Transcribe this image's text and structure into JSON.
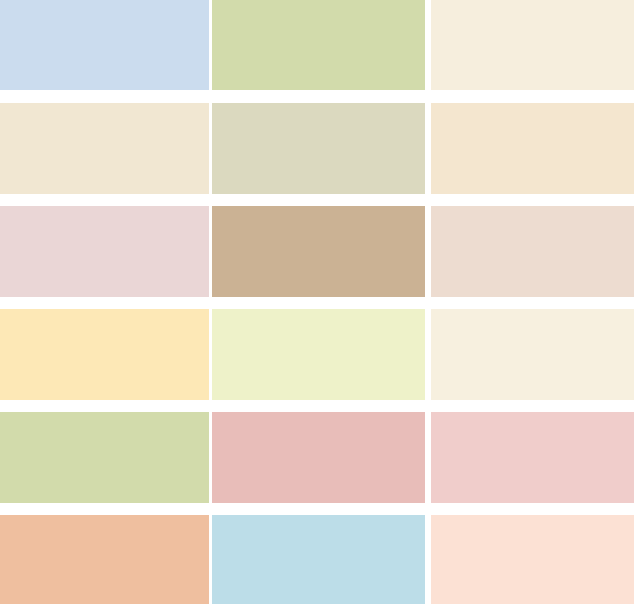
{
  "palette": {
    "swatches": [
      {
        "color": "#cbdcee"
      },
      {
        "color": "#d2dbab"
      },
      {
        "color": "#f6eedd"
      },
      {
        "color": "#f1e7d2"
      },
      {
        "color": "#dbd9bf"
      },
      {
        "color": "#f4e6cf"
      },
      {
        "color": "#ead6d6"
      },
      {
        "color": "#cbb294"
      },
      {
        "color": "#eddcd0"
      },
      {
        "color": "#fde8b6"
      },
      {
        "color": "#eef2c9"
      },
      {
        "color": "#f7f0df"
      },
      {
        "color": "#d2dbab"
      },
      {
        "color": "#e8bdb9"
      },
      {
        "color": "#f0cdcb"
      },
      {
        "color": "#efbf9f"
      },
      {
        "color": "#bcdde8"
      },
      {
        "color": "#fce1d4"
      }
    ]
  }
}
